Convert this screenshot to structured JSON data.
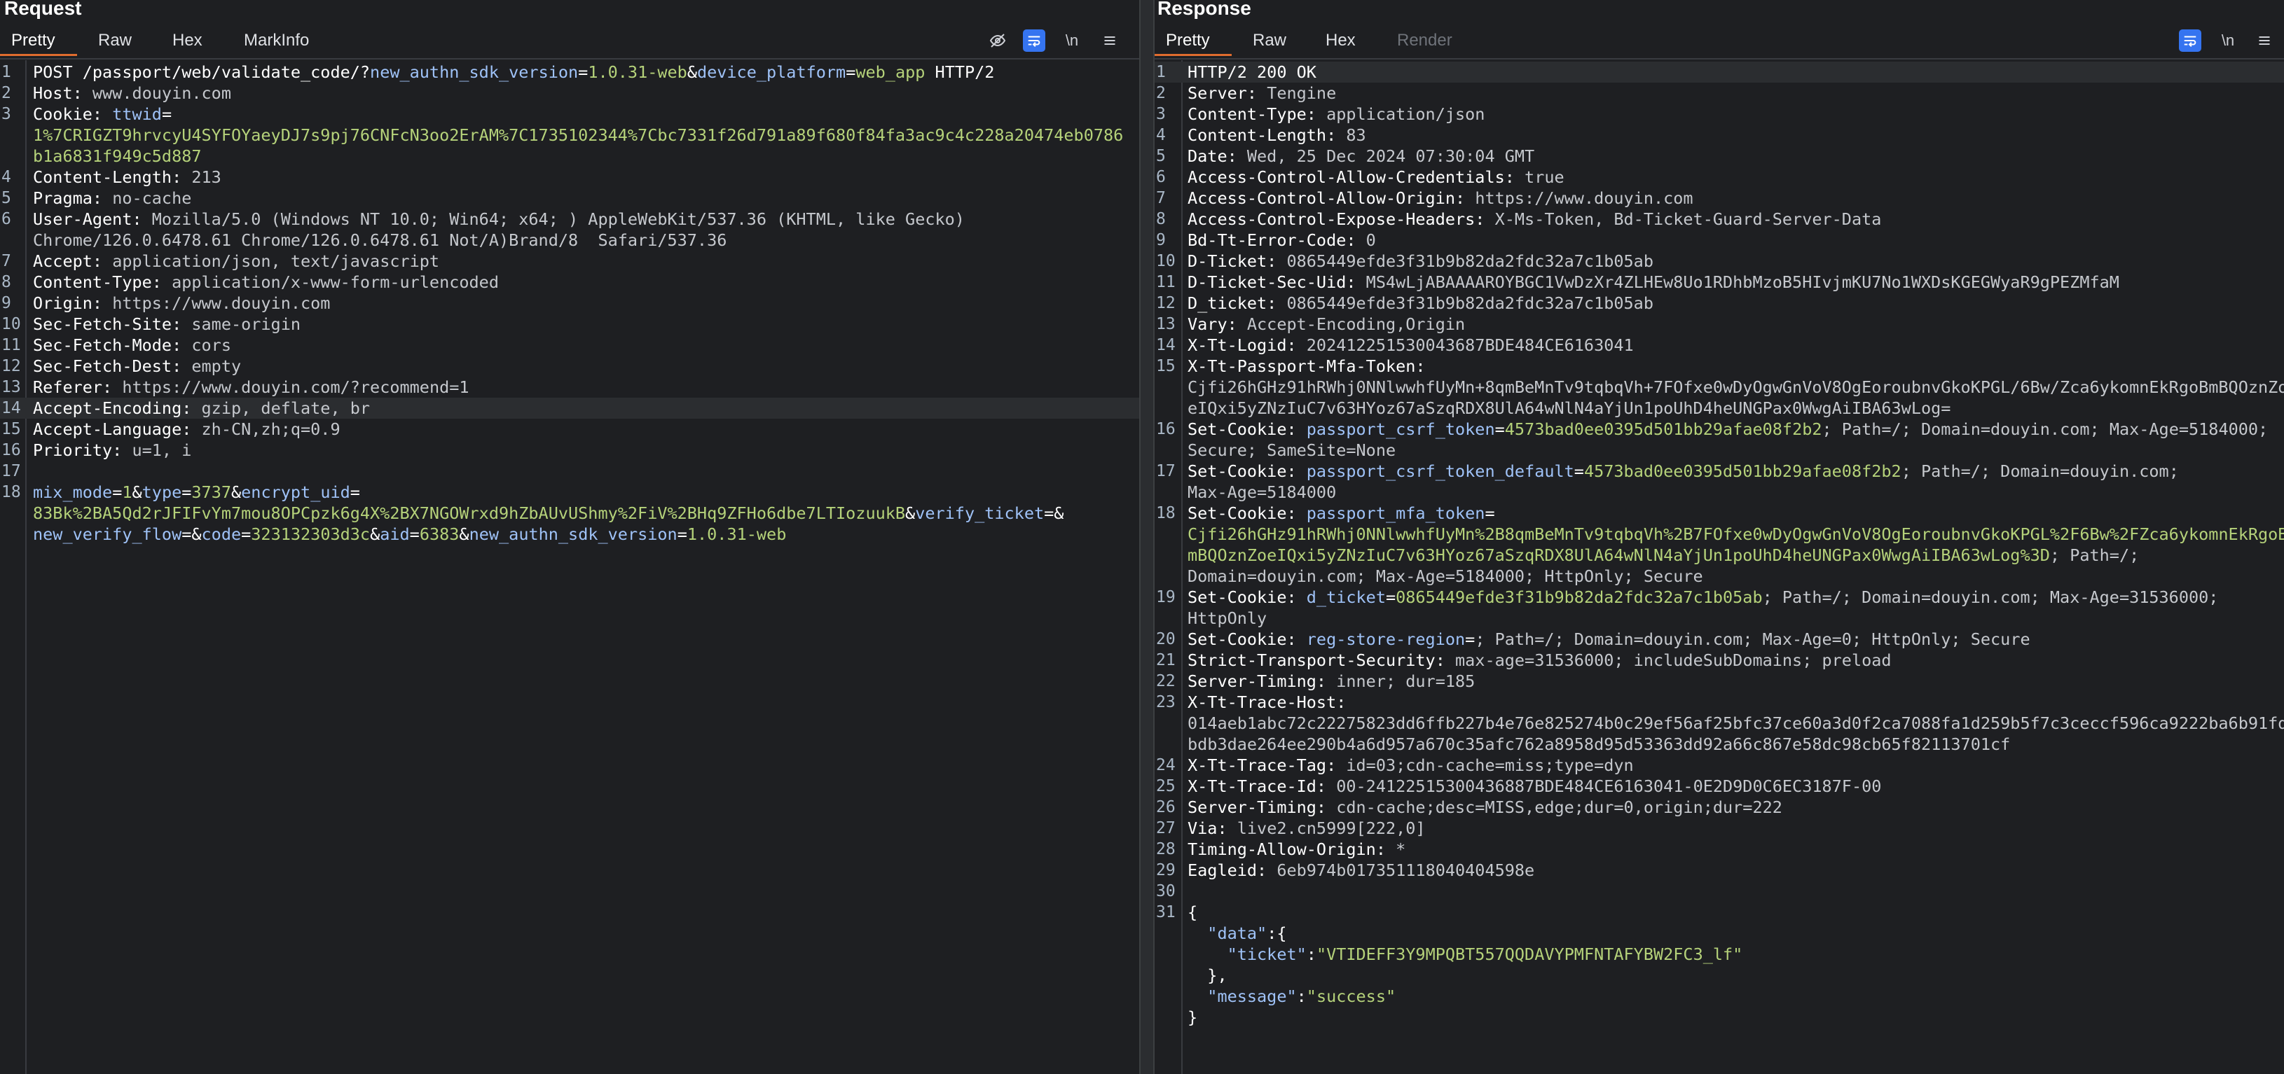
{
  "request": {
    "title": "Request",
    "tabs": [
      "Pretty",
      "Raw",
      "Hex",
      "MarkInfo"
    ],
    "toolbar": {
      "eye_icon": "eye-slash-icon",
      "wrap_icon": "wrap-icon",
      "newline_label": "\\n",
      "menu_icon": "hamburger-icon"
    },
    "lines": [
      {
        "n": "1",
        "segs": [
          [
            "hdr",
            "POST /passport/web/validate_code/?"
          ],
          [
            "cyan",
            "new_authn_sdk_version"
          ],
          [
            "op",
            "="
          ],
          [
            "grn",
            "1.0.31-web"
          ],
          [
            "op",
            "&"
          ],
          [
            "cyan",
            "device_platform"
          ],
          [
            "op",
            "="
          ],
          [
            "grn",
            "web_app"
          ],
          [
            "hdr",
            " HTTP/2"
          ]
        ]
      },
      {
        "n": "2",
        "segs": [
          [
            "hdr",
            "Host: "
          ],
          [
            "val",
            "www.douyin.com"
          ]
        ]
      },
      {
        "n": "3",
        "segs": [
          [
            "hdr",
            "Cookie: "
          ],
          [
            "cyan",
            "ttwid"
          ],
          [
            "op",
            "="
          ]
        ]
      },
      {
        "n": "",
        "segs": [
          [
            "grn",
            "1%7CRIGZT9hrvcyU4SYFOYaeyDJ7s9pj76CNFcN3oo2ErAM%7C1735102344%7Cbc7331f26d791a89f680f84fa3ac9c4c228a20474eb0786"
          ]
        ]
      },
      {
        "n": "",
        "segs": [
          [
            "grn",
            "b1a6831f949c5d887"
          ]
        ]
      },
      {
        "n": "4",
        "segs": [
          [
            "hdr",
            "Content-Length: "
          ],
          [
            "val",
            "213"
          ]
        ]
      },
      {
        "n": "5",
        "segs": [
          [
            "hdr",
            "Pragma: "
          ],
          [
            "val",
            "no-cache"
          ]
        ]
      },
      {
        "n": "6",
        "segs": [
          [
            "hdr",
            "User-Agent: "
          ],
          [
            "val",
            "Mozilla/5.0 (Windows NT 10.0; Win64; x64; ) AppleWebKit/537.36 (KHTML, like Gecko)"
          ]
        ]
      },
      {
        "n": "",
        "segs": [
          [
            "val",
            "Chrome/126.0.6478.61 Chrome/126.0.6478.61 Not/A)Brand/8  Safari/537.36"
          ]
        ]
      },
      {
        "n": "7",
        "segs": [
          [
            "hdr",
            "Accept: "
          ],
          [
            "val",
            "application/json, text/javascript"
          ]
        ]
      },
      {
        "n": "8",
        "segs": [
          [
            "hdr",
            "Content-Type: "
          ],
          [
            "val",
            "application/x-www-form-urlencoded"
          ]
        ]
      },
      {
        "n": "9",
        "segs": [
          [
            "hdr",
            "Origin: "
          ],
          [
            "val",
            "https://www.douyin.com"
          ]
        ]
      },
      {
        "n": "10",
        "segs": [
          [
            "hdr",
            "Sec-Fetch-Site: "
          ],
          [
            "val",
            "same-origin"
          ]
        ]
      },
      {
        "n": "11",
        "segs": [
          [
            "hdr",
            "Sec-Fetch-Mode: "
          ],
          [
            "val",
            "cors"
          ]
        ]
      },
      {
        "n": "12",
        "segs": [
          [
            "hdr",
            "Sec-Fetch-Dest: "
          ],
          [
            "val",
            "empty"
          ]
        ]
      },
      {
        "n": "13",
        "segs": [
          [
            "hdr",
            "Referer: "
          ],
          [
            "val",
            "https://www.douyin.com/?recommend=1"
          ]
        ]
      },
      {
        "n": "14",
        "hl": true,
        "segs": [
          [
            "hdr",
            "Accept-Encoding: "
          ],
          [
            "val",
            "gzip, deflate, br"
          ]
        ]
      },
      {
        "n": "15",
        "segs": [
          [
            "hdr",
            "Accept-Language: "
          ],
          [
            "val",
            "zh-CN,zh;q=0.9"
          ]
        ]
      },
      {
        "n": "16",
        "segs": [
          [
            "hdr",
            "Priority: "
          ],
          [
            "val",
            "u=1, i"
          ]
        ]
      },
      {
        "n": "17",
        "segs": []
      },
      {
        "n": "18",
        "segs": [
          [
            "cyan",
            "mix_mode"
          ],
          [
            "op",
            "="
          ],
          [
            "grn",
            "1"
          ],
          [
            "op",
            "&"
          ],
          [
            "cyan",
            "type"
          ],
          [
            "op",
            "="
          ],
          [
            "grn",
            "3737"
          ],
          [
            "op",
            "&"
          ],
          [
            "cyan",
            "encrypt_uid"
          ],
          [
            "op",
            "="
          ]
        ]
      },
      {
        "n": "",
        "segs": [
          [
            "grn",
            "83Bk%2BA5Qd2rJFIFvYm7mou8OPCpzk6g4X%2BX7NGOWrxd9hZbAUvUShmy%2FiV%2BHq9ZFHo6dbe7LTIozuukB"
          ],
          [
            "op",
            "&"
          ],
          [
            "cyan",
            "verify_ticket"
          ],
          [
            "op",
            "=&"
          ]
        ]
      },
      {
        "n": "",
        "segs": [
          [
            "cyan",
            "new_verify_flow"
          ],
          [
            "op",
            "=&"
          ],
          [
            "cyan",
            "code"
          ],
          [
            "op",
            "="
          ],
          [
            "grn",
            "323132303d3c"
          ],
          [
            "op",
            "&"
          ],
          [
            "cyan",
            "aid"
          ],
          [
            "op",
            "="
          ],
          [
            "grn",
            "6383"
          ],
          [
            "op",
            "&"
          ],
          [
            "cyan",
            "new_authn_sdk_version"
          ],
          [
            "op",
            "="
          ],
          [
            "grn",
            "1.0.31-web"
          ]
        ]
      }
    ]
  },
  "response": {
    "title": "Response",
    "tabs": [
      "Pretty",
      "Raw",
      "Hex",
      "Render"
    ],
    "toolbar": {
      "wrap_icon": "wrap-icon",
      "newline_label": "\\n",
      "menu_icon": "hamburger-icon"
    },
    "lines": [
      {
        "n": "1",
        "hl": true,
        "segs": [
          [
            "hdr",
            "HTTP/2 200 OK"
          ]
        ]
      },
      {
        "n": "2",
        "segs": [
          [
            "hdr",
            "Server: "
          ],
          [
            "val",
            "Tengine"
          ]
        ]
      },
      {
        "n": "3",
        "segs": [
          [
            "hdr",
            "Content-Type: "
          ],
          [
            "val",
            "application/json"
          ]
        ]
      },
      {
        "n": "4",
        "segs": [
          [
            "hdr",
            "Content-Length: "
          ],
          [
            "val",
            "83"
          ]
        ]
      },
      {
        "n": "5",
        "segs": [
          [
            "hdr",
            "Date: "
          ],
          [
            "val",
            "Wed, 25 Dec 2024 07:30:04 GMT"
          ]
        ]
      },
      {
        "n": "6",
        "segs": [
          [
            "hdr",
            "Access-Control-Allow-Credentials: "
          ],
          [
            "val",
            "true"
          ]
        ]
      },
      {
        "n": "7",
        "segs": [
          [
            "hdr",
            "Access-Control-Allow-Origin: "
          ],
          [
            "val",
            "https://www.douyin.com"
          ]
        ]
      },
      {
        "n": "8",
        "segs": [
          [
            "hdr",
            "Access-Control-Expose-Headers: "
          ],
          [
            "val",
            "X-Ms-Token, Bd-Ticket-Guard-Server-Data"
          ]
        ]
      },
      {
        "n": "9",
        "segs": [
          [
            "hdr",
            "Bd-Tt-Error-Code: "
          ],
          [
            "val",
            "0"
          ]
        ]
      },
      {
        "n": "10",
        "segs": [
          [
            "hdr",
            "D-Ticket: "
          ],
          [
            "val",
            "0865449efde3f31b9b82da2fdc32a7c1b05ab"
          ]
        ]
      },
      {
        "n": "11",
        "segs": [
          [
            "hdr",
            "D-Ticket-Sec-Uid: "
          ],
          [
            "val",
            "MS4wLjABAAAAROYBGC1VwDzXr4ZLHEw8Uo1RDhbMzoB5HIvjmKU7No1WXDsKGEGWyaR9gPEZMfaM"
          ]
        ]
      },
      {
        "n": "12",
        "segs": [
          [
            "hdr",
            "D_ticket: "
          ],
          [
            "val",
            "0865449efde3f31b9b82da2fdc32a7c1b05ab"
          ]
        ]
      },
      {
        "n": "13",
        "segs": [
          [
            "hdr",
            "Vary: "
          ],
          [
            "val",
            "Accept-Encoding,Origin"
          ]
        ]
      },
      {
        "n": "14",
        "segs": [
          [
            "hdr",
            "X-Tt-Logid: "
          ],
          [
            "val",
            "202412251530043687BDE484CE6163041"
          ]
        ]
      },
      {
        "n": "15",
        "segs": [
          [
            "hdr",
            "X-Tt-Passport-Mfa-Token: "
          ]
        ]
      },
      {
        "n": "",
        "segs": [
          [
            "val",
            "Cjfi26hGHz91hRWhj0NNlwwhfUyMn+8qmBeMnTv9tqbqVh+7FOfxe0wDyOgwGnVoV8OgEoroubnvGkoKPGL/6Bw/Zca6ykomnEkRgoBmBQOznZo"
          ]
        ]
      },
      {
        "n": "",
        "segs": [
          [
            "val",
            "eIQxi5yZNzIuC7v63HYoz67aSzqRDX8UlA64wNlN4aYjUn1poUhD4heUNGPax0WwgAiIBA63wLog="
          ]
        ]
      },
      {
        "n": "16",
        "segs": [
          [
            "hdr",
            "Set-Cookie: "
          ],
          [
            "cyan",
            "passport_csrf_token"
          ],
          [
            "op",
            "="
          ],
          [
            "grn",
            "4573bad0ee0395d501bb29afae08f2b2"
          ],
          [
            "val",
            "; Path=/; Domain=douyin.com; Max-Age=5184000;"
          ]
        ]
      },
      {
        "n": "",
        "segs": [
          [
            "val",
            "Secure; SameSite=None"
          ]
        ]
      },
      {
        "n": "17",
        "segs": [
          [
            "hdr",
            "Set-Cookie: "
          ],
          [
            "cyan",
            "passport_csrf_token_default"
          ],
          [
            "op",
            "="
          ],
          [
            "grn",
            "4573bad0ee0395d501bb29afae08f2b2"
          ],
          [
            "val",
            "; Path=/; Domain=douyin.com;"
          ]
        ]
      },
      {
        "n": "",
        "segs": [
          [
            "val",
            "Max-Age=5184000"
          ]
        ]
      },
      {
        "n": "18",
        "segs": [
          [
            "hdr",
            "Set-Cookie: "
          ],
          [
            "cyan",
            "passport_mfa_token"
          ],
          [
            "op",
            "="
          ]
        ]
      },
      {
        "n": "",
        "segs": [
          [
            "grn",
            "Cjfi26hGHz91hRWhj0NNlwwhfUyMn%2B8qmBeMnTv9tqbqVh%2B7FOfxe0wDyOgwGnVoV8OgEoroubnvGkoKPGL%2F6Bw%2FZca6ykomnEkRgoB"
          ]
        ]
      },
      {
        "n": "",
        "segs": [
          [
            "grn",
            "mBQOznZoeIQxi5yZNzIuC7v63HYoz67aSzqRDX8UlA64wNlN4aYjUn1poUhD4heUNGPax0WwgAiIBA63wLog%3D"
          ],
          [
            "val",
            "; Path=/;"
          ]
        ]
      },
      {
        "n": "",
        "segs": [
          [
            "val",
            "Domain=douyin.com; Max-Age=5184000; HttpOnly; Secure"
          ]
        ]
      },
      {
        "n": "19",
        "segs": [
          [
            "hdr",
            "Set-Cookie: "
          ],
          [
            "cyan",
            "d_ticket"
          ],
          [
            "op",
            "="
          ],
          [
            "grn",
            "0865449efde3f31b9b82da2fdc32a7c1b05ab"
          ],
          [
            "val",
            "; Path=/; Domain=douyin.com; Max-Age=31536000;"
          ]
        ]
      },
      {
        "n": "",
        "segs": [
          [
            "val",
            "HttpOnly"
          ]
        ]
      },
      {
        "n": "20",
        "segs": [
          [
            "hdr",
            "Set-Cookie: "
          ],
          [
            "cyan",
            "reg-store-region"
          ],
          [
            "op",
            "="
          ],
          [
            "val",
            "; Path=/; Domain=douyin.com; Max-Age=0; HttpOnly; Secure"
          ]
        ]
      },
      {
        "n": "21",
        "segs": [
          [
            "hdr",
            "Strict-Transport-Security: "
          ],
          [
            "val",
            "max-age=31536000; includeSubDomains; preload"
          ]
        ]
      },
      {
        "n": "22",
        "segs": [
          [
            "hdr",
            "Server-Timing: "
          ],
          [
            "val",
            "inner; dur=185"
          ]
        ]
      },
      {
        "n": "23",
        "segs": [
          [
            "hdr",
            "X-Tt-Trace-Host: "
          ]
        ]
      },
      {
        "n": "",
        "segs": [
          [
            "val",
            "014aeb1abc72c22275823dd6ffb227b4e76e825274b0c29ef56af25bfc37ce60a3d0f2ca7088fa1d259b5f7c3ceccf596ca9222ba6b91fd"
          ]
        ]
      },
      {
        "n": "",
        "segs": [
          [
            "val",
            "bdb3dae264ee290b4a6d957a670c35afc762a8958d95d53363dd92a66c867e58dc98cb65f82113701cf"
          ]
        ]
      },
      {
        "n": "24",
        "segs": [
          [
            "hdr",
            "X-Tt-Trace-Tag: "
          ],
          [
            "val",
            "id=03;cdn-cache=miss;type=dyn"
          ]
        ]
      },
      {
        "n": "25",
        "segs": [
          [
            "hdr",
            "X-Tt-Trace-Id: "
          ],
          [
            "val",
            "00-24122515300436887BDE484CE6163041-0E2D9D0C6EC3187F-00"
          ]
        ]
      },
      {
        "n": "26",
        "segs": [
          [
            "hdr",
            "Server-Timing: "
          ],
          [
            "val",
            "cdn-cache;desc=MISS,edge;dur=0,origin;dur=222"
          ]
        ]
      },
      {
        "n": "27",
        "segs": [
          [
            "hdr",
            "Via: "
          ],
          [
            "val",
            "live2.cn5999[222,0]"
          ]
        ]
      },
      {
        "n": "28",
        "segs": [
          [
            "hdr",
            "Timing-Allow-Origin: "
          ],
          [
            "val",
            "*"
          ]
        ]
      },
      {
        "n": "29",
        "segs": [
          [
            "hdr",
            "Eagleid: "
          ],
          [
            "val",
            "6eb974b017351118040404598e"
          ]
        ]
      },
      {
        "n": "30",
        "segs": []
      },
      {
        "n": "31",
        "segs": [
          [
            "op",
            "{"
          ]
        ]
      },
      {
        "n": "",
        "segs": [
          [
            "op",
            "  "
          ],
          [
            "cyan",
            "\"data\""
          ],
          [
            "op",
            ":{"
          ]
        ]
      },
      {
        "n": "",
        "segs": [
          [
            "op",
            "    "
          ],
          [
            "cyan",
            "\"ticket\""
          ],
          [
            "op",
            ":"
          ],
          [
            "grn",
            "\"VTIDEFF3Y9MPQBT557QQDAVYPMFNTAFYBW2FC3_lf\""
          ]
        ]
      },
      {
        "n": "",
        "segs": [
          [
            "op",
            "  },"
          ]
        ]
      },
      {
        "n": "",
        "segs": [
          [
            "op",
            "  "
          ],
          [
            "cyan",
            "\"message\""
          ],
          [
            "op",
            ":"
          ],
          [
            "grn",
            "\"success\""
          ]
        ]
      },
      {
        "n": "",
        "segs": [
          [
            "op",
            "}"
          ]
        ]
      }
    ]
  }
}
